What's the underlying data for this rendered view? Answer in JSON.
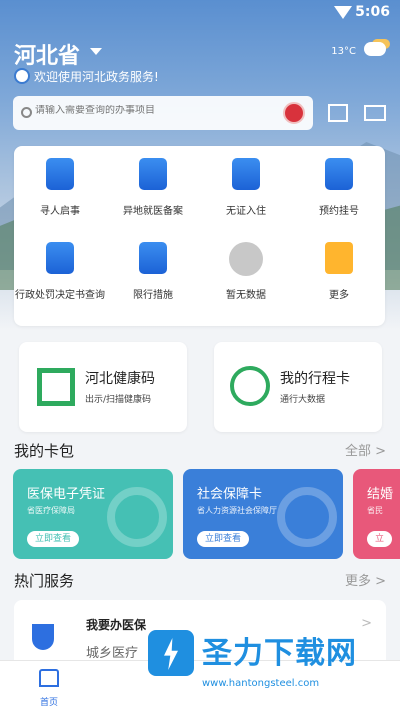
{
  "status": {
    "time": "5:06"
  },
  "header": {
    "region": "河北省",
    "welcome": "欢迎使用河北政务服务!",
    "weather_temp": "13°C"
  },
  "search": {
    "placeholder": "请输入需要查询的办事项目"
  },
  "services": [
    {
      "label": "寻人启事",
      "icon": "person-card-icon"
    },
    {
      "label": "异地就医备案",
      "icon": "hospital-icon"
    },
    {
      "label": "无证入住",
      "icon": "building-id-icon"
    },
    {
      "label": "预约挂号",
      "icon": "clock-document-icon"
    },
    {
      "label": "行政处罚决定书查询",
      "icon": "penalty-shield-icon"
    },
    {
      "label": "限行措施",
      "icon": "car-restriction-icon"
    },
    {
      "label": "暂无数据",
      "icon": "placeholder-icon"
    },
    {
      "label": "更多",
      "icon": "more-grid-icon"
    }
  ],
  "codes": {
    "health": {
      "title": "河北健康码",
      "sub": "出示/扫描健康码"
    },
    "trip": {
      "title": "我的行程卡",
      "sub": "通行大数据"
    }
  },
  "wallet": {
    "title": "我的卡包",
    "more": "全部 >",
    "cards": [
      {
        "title": "医保电子凭证",
        "sub": "省医疗保障局",
        "button": "立即查看"
      },
      {
        "title": "社会保障卡",
        "sub": "省人力资源社会保障厅",
        "button": "立即查看"
      },
      {
        "title": "结婚",
        "sub": "省民",
        "button": "立"
      }
    ]
  },
  "hot": {
    "title": "热门服务",
    "more": "更多 >",
    "item": {
      "title": "我要办医保",
      "sub": "城乡医疗"
    }
  },
  "tabbar": {
    "home": "首页"
  },
  "watermark": {
    "text": "圣力下载网",
    "url": "www.hantongsteel.com"
  },
  "colors": {
    "primary": "#2d6fe0",
    "green": "#2eaa5e",
    "teal": "#3fc3b6",
    "blue": "#3a7fd9",
    "pink": "#e8587a"
  }
}
